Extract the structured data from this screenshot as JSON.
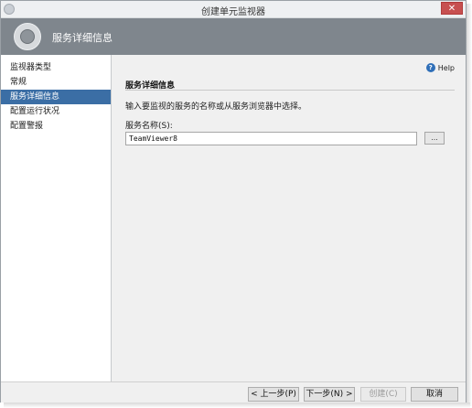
{
  "window": {
    "title": "创建单元监视器",
    "close_glyph": "✕"
  },
  "header": {
    "title": "服务详细信息"
  },
  "sidebar": {
    "items": [
      {
        "label": "监视器类型",
        "active": false
      },
      {
        "label": "常规",
        "active": false
      },
      {
        "label": "服务详细信息",
        "active": true
      },
      {
        "label": "配置运行状况",
        "active": false
      },
      {
        "label": "配置警报",
        "active": false
      }
    ]
  },
  "content": {
    "help_label": "Help",
    "help_icon_glyph": "?",
    "section_title": "服务详细信息",
    "description": "输入要监视的服务的名称或从服务浏览器中选择。",
    "service_label": "服务名称(S):",
    "service_value": "TeamViewer8",
    "browse_label": "..."
  },
  "footer": {
    "prev_label": "< 上一步(P)",
    "next_label": "下一步(N) >",
    "create_label": "创建(C)",
    "cancel_label": "取消"
  },
  "colors": {
    "header_bg": "#7f868d",
    "active_item_bg": "#3b6ea5",
    "close_bg": "#c75050"
  }
}
